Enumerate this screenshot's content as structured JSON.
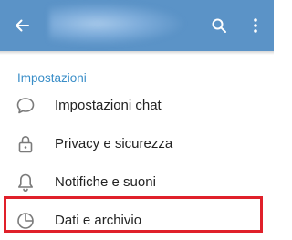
{
  "header": {
    "back_icon": "arrow-left-icon",
    "search_icon": "search-icon",
    "more_icon": "more-vertical-icon",
    "color": "#5b93c7"
  },
  "section": {
    "title": "Impostazioni"
  },
  "items": [
    {
      "label": "Impostazioni chat",
      "icon": "chat-bubble-icon"
    },
    {
      "label": "Privacy e sicurezza",
      "icon": "lock-icon"
    },
    {
      "label": "Notifiche e suoni",
      "icon": "bell-icon"
    },
    {
      "label": "Dati e archivio",
      "icon": "clock-pie-icon"
    }
  ],
  "highlight_color": "#e0202a"
}
